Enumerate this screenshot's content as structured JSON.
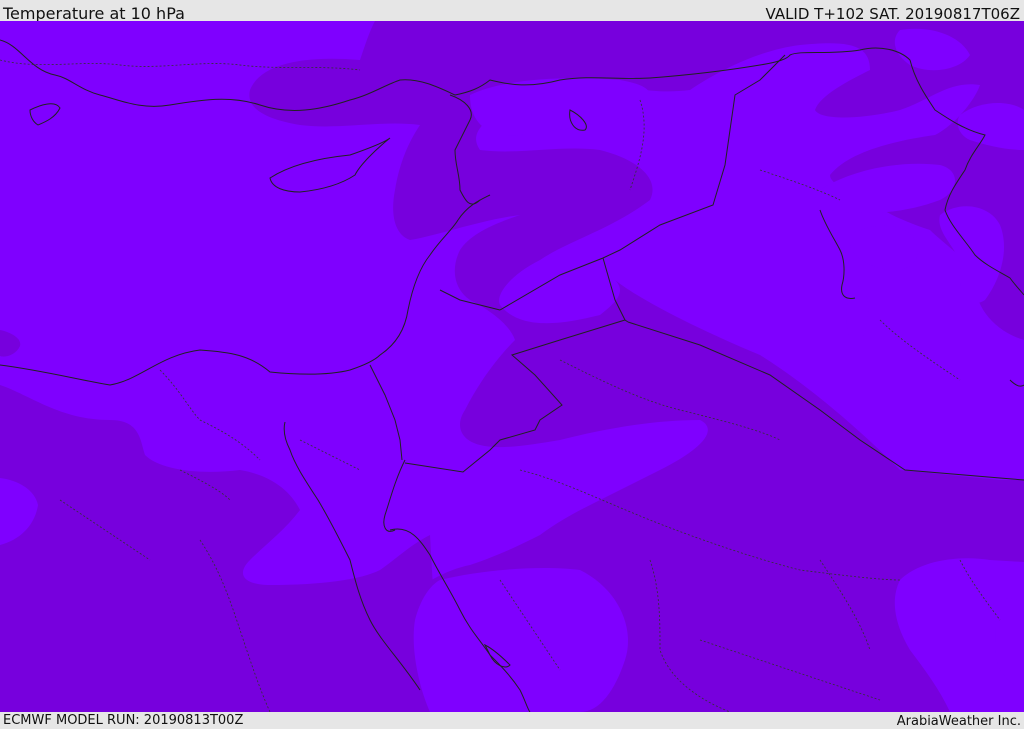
{
  "header": {
    "title": "Temperature at 10 hPa",
    "valid": "VALID T+102 SAT. 20190817T06Z"
  },
  "footer": {
    "model_run": "ECMWF MODEL RUN: 20190813T00Z",
    "credit": "ArabiaWeather Inc."
  },
  "map": {
    "colors": {
      "light_band": "#7f00ff",
      "dark_band": "#7700dd",
      "border": "#222222"
    }
  }
}
